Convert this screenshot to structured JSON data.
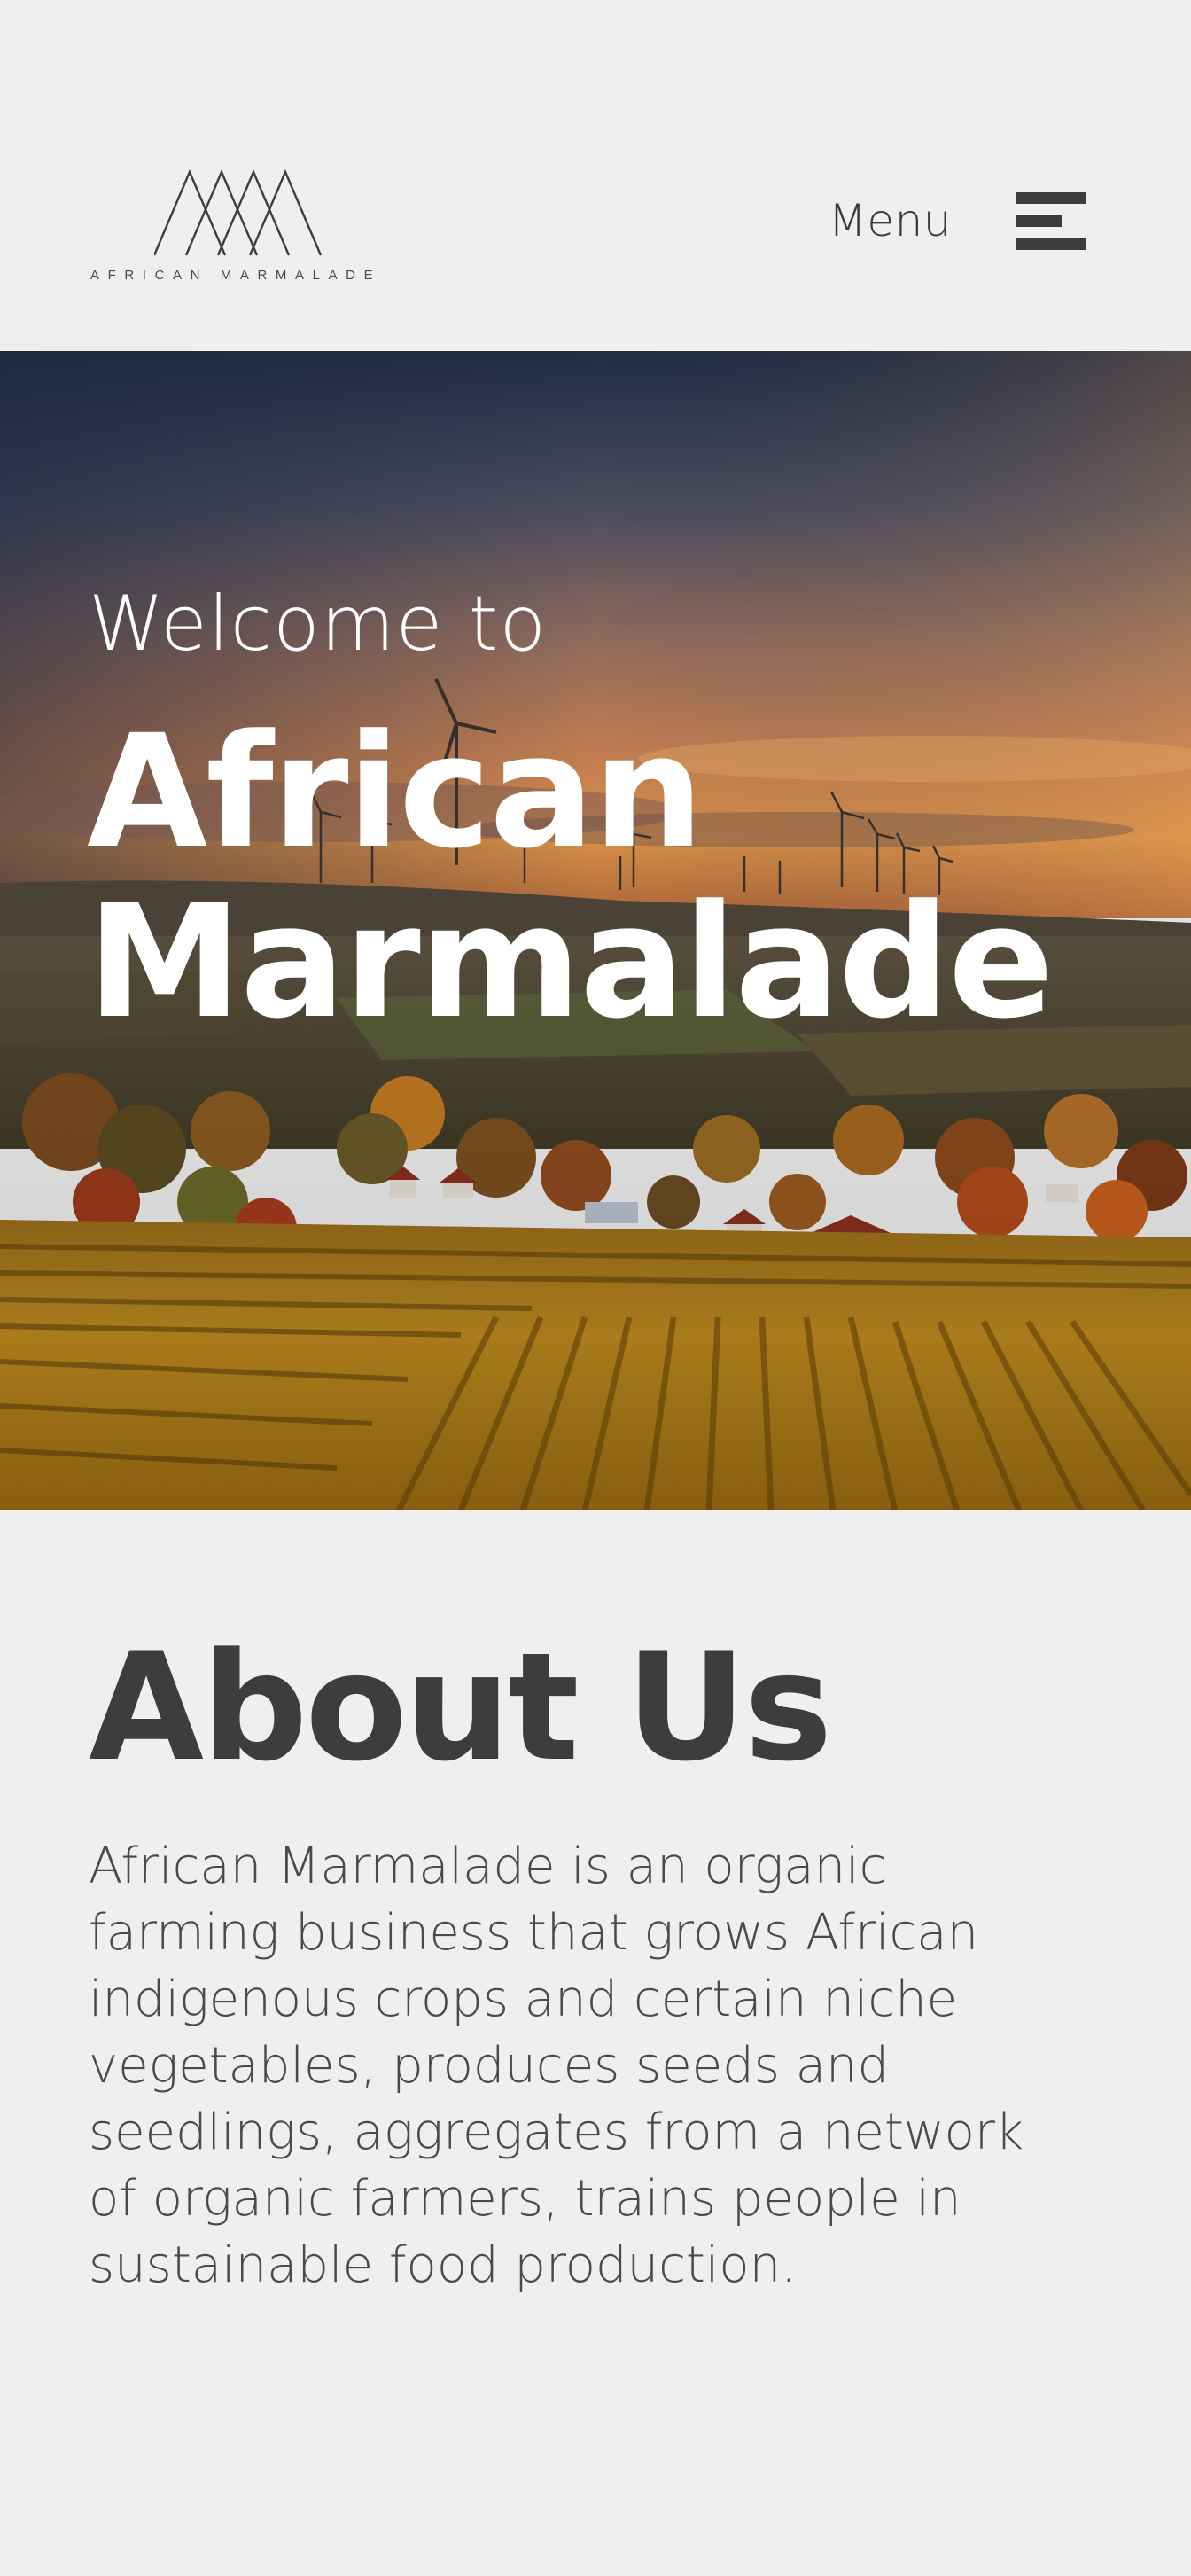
{
  "header": {
    "logo_text": "AFRICAN MARMALADE",
    "menu_label": "Menu"
  },
  "hero": {
    "welcome": "Welcome to",
    "title": "African Marmalade"
  },
  "about": {
    "heading": "About Us",
    "body": "African Marmalade is an organic farming business that grows African indigenous crops and certain niche vegetables, produces seeds and seedlings, aggregates from a network of organic farmers, trains people in sustainable food production."
  },
  "colors": {
    "background": "#efefef",
    "text_dark": "#3d3d3d",
    "hero_text": "#ffffff",
    "sky_top": "#2a3956",
    "sunset": "#e08a45",
    "fields": "#c9921e"
  },
  "icons": {
    "logo": "mountain-peaks-icon",
    "menu": "hamburger-icon"
  }
}
